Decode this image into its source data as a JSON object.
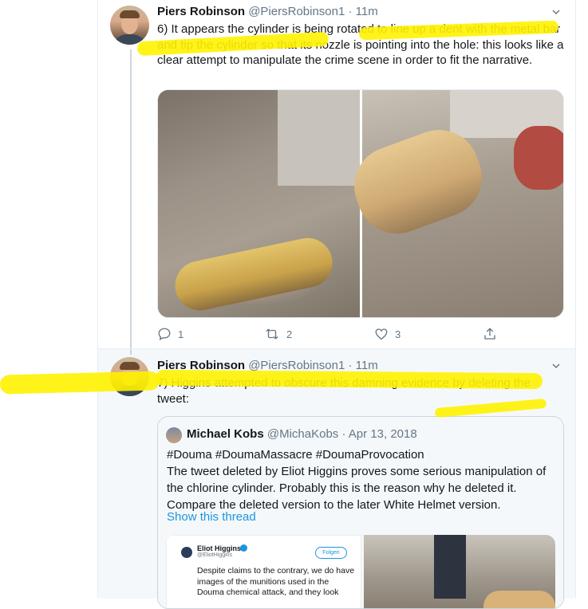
{
  "tweets": [
    {
      "author_name": "Piers Robinson",
      "author_handle": "@PiersRobinson1",
      "time": "· 11m",
      "text": "6) It appears the cylinder is being rotated to line up a dent with the metal bar and tip the cylinder so that its nozzle is pointing into the hole: this looks like a clear attempt to manipulate the crime scene in order to fit the narrative.",
      "replies": "1",
      "retweets": "2",
      "likes": "3"
    },
    {
      "author_name": "Piers Robinson",
      "author_handle": "@PiersRobinson1",
      "time": "· 11m",
      "text": "7) Higgins attempted to obscure this damning evidence by deleting the tweet:",
      "quoted": {
        "author_name": "Michael Kobs",
        "author_handle": "@MichaKobs",
        "date": "· Apr 13, 2018",
        "text": "#Douma #DoumaMassacre #DoumaProvocation\nThe tweet deleted by Eliot Higgins proves some serious manipulation of the chlorine cylinder. Probably this is the reason why he deleted it. Compare the deleted version to the later White Helmet version.",
        "show_thread": "Show this thread",
        "embedded": {
          "author_name": "Eliot Higgins",
          "author_handle": "@EliotHiggins",
          "follow_label": "Folgen",
          "text": "Despite claims to the contrary, we do have images of the munitions used in the Douma chemical attack, and they look"
        }
      }
    }
  ],
  "colors": {
    "highlight": "#fff200",
    "link": "#1b95e0",
    "muted": "#657786"
  }
}
